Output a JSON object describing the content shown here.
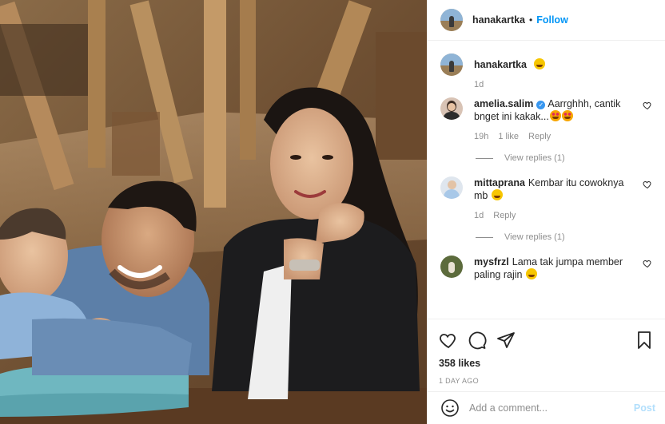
{
  "post": {
    "author": "hanakartka",
    "follow_label": "Follow",
    "separator": "•",
    "caption_emoji": "smile",
    "caption_time": "1d"
  },
  "comments": [
    {
      "username": "amelia.salim",
      "verified": true,
      "text": "Aarrghhh, cantik bnget ini kakak...",
      "emoji": "heart-eyes x2",
      "time": "19h",
      "likes": "1 like",
      "reply_label": "Reply",
      "view_replies": "View replies (1)"
    },
    {
      "username": "mittaprana",
      "verified": false,
      "text": "Kembar itu cowoknya mb",
      "emoji": "laugh",
      "time": "1d",
      "reply_label": "Reply",
      "view_replies": "View replies (1)"
    },
    {
      "username": "mysfrzl",
      "verified": false,
      "text": "Lama tak jumpa member paling rajin",
      "emoji": "scream"
    }
  ],
  "actions": {
    "likes": "358 likes",
    "timestamp": "1 DAY AGO",
    "icons": [
      "heart-icon",
      "comment-icon",
      "share-icon",
      "bookmark-icon"
    ]
  },
  "add_comment": {
    "placeholder": "Add a comment...",
    "post_label": "Post"
  },
  "colors": {
    "accent": "#0095f6",
    "post_disabled": "#b2dffc",
    "muted": "#8e8e8e",
    "verified": "#3897f0"
  }
}
